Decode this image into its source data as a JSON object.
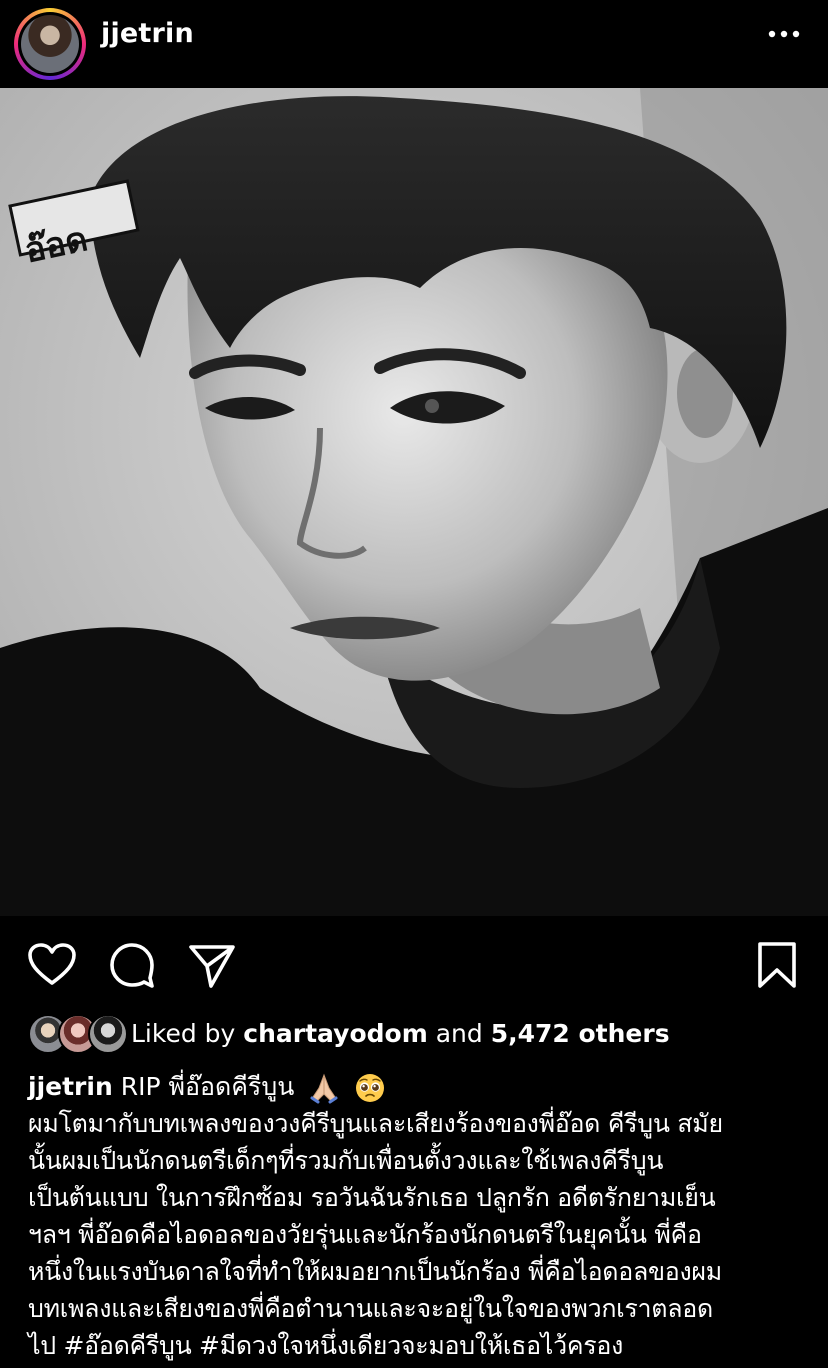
{
  "post": {
    "username": "jjetrin",
    "photo_text": "อ๊อด"
  },
  "icons": {
    "more": "more-horizontal-icon",
    "like": "heart-icon",
    "comment": "comment-icon",
    "share": "send-icon",
    "save": "bookmark-icon",
    "pray": "folded-hands-emoji",
    "pleading": "pleading-face-emoji"
  },
  "likes": {
    "prefix": "Liked by",
    "user": "chartayodom",
    "middle": "and",
    "count": "5,472 others"
  },
  "caption": {
    "user": "jjetrin",
    "title": "RIP พี่อ๊อดคีรีบูน",
    "lines": [
      "ผมโตมากับบทเพลงของวงคีรีบูนและเสียงร้องของพี่อ๊อด คีรีบูน สมัย",
      "นั้นผมเป็นนักดนตรีเด็กๆที่รวมกับเพื่อนตั้งวงและใช้เพลงคีรีบูน",
      "เป็นต้นแบบ ในการฝึกซ้อม รอวันฉันรักเธอ ปลูกรัก อดีตรักยามเย็น",
      "ฯลฯ พี่อ๊อดคือไอดอลของวัยรุ่นและนักร้องนักดนตรีในยุคนั้น พี่คือ",
      "หนึ่งในแรงบันดาลใจที่ทำให้ผมอยากเป็นนักร้อง พี่คือไอดอลของผม",
      "บทเพลงและเสียงของพี่คือตำนานและจะอยู่ในใจของพวกเราตลอด",
      "ไป #อ๊อดคีรีบูน #มีดวงใจหนึ่งเดียวจะมอบให้เธอไว้ครอง"
    ]
  },
  "colors": {
    "background": "#000000",
    "text": "#ffffff"
  }
}
